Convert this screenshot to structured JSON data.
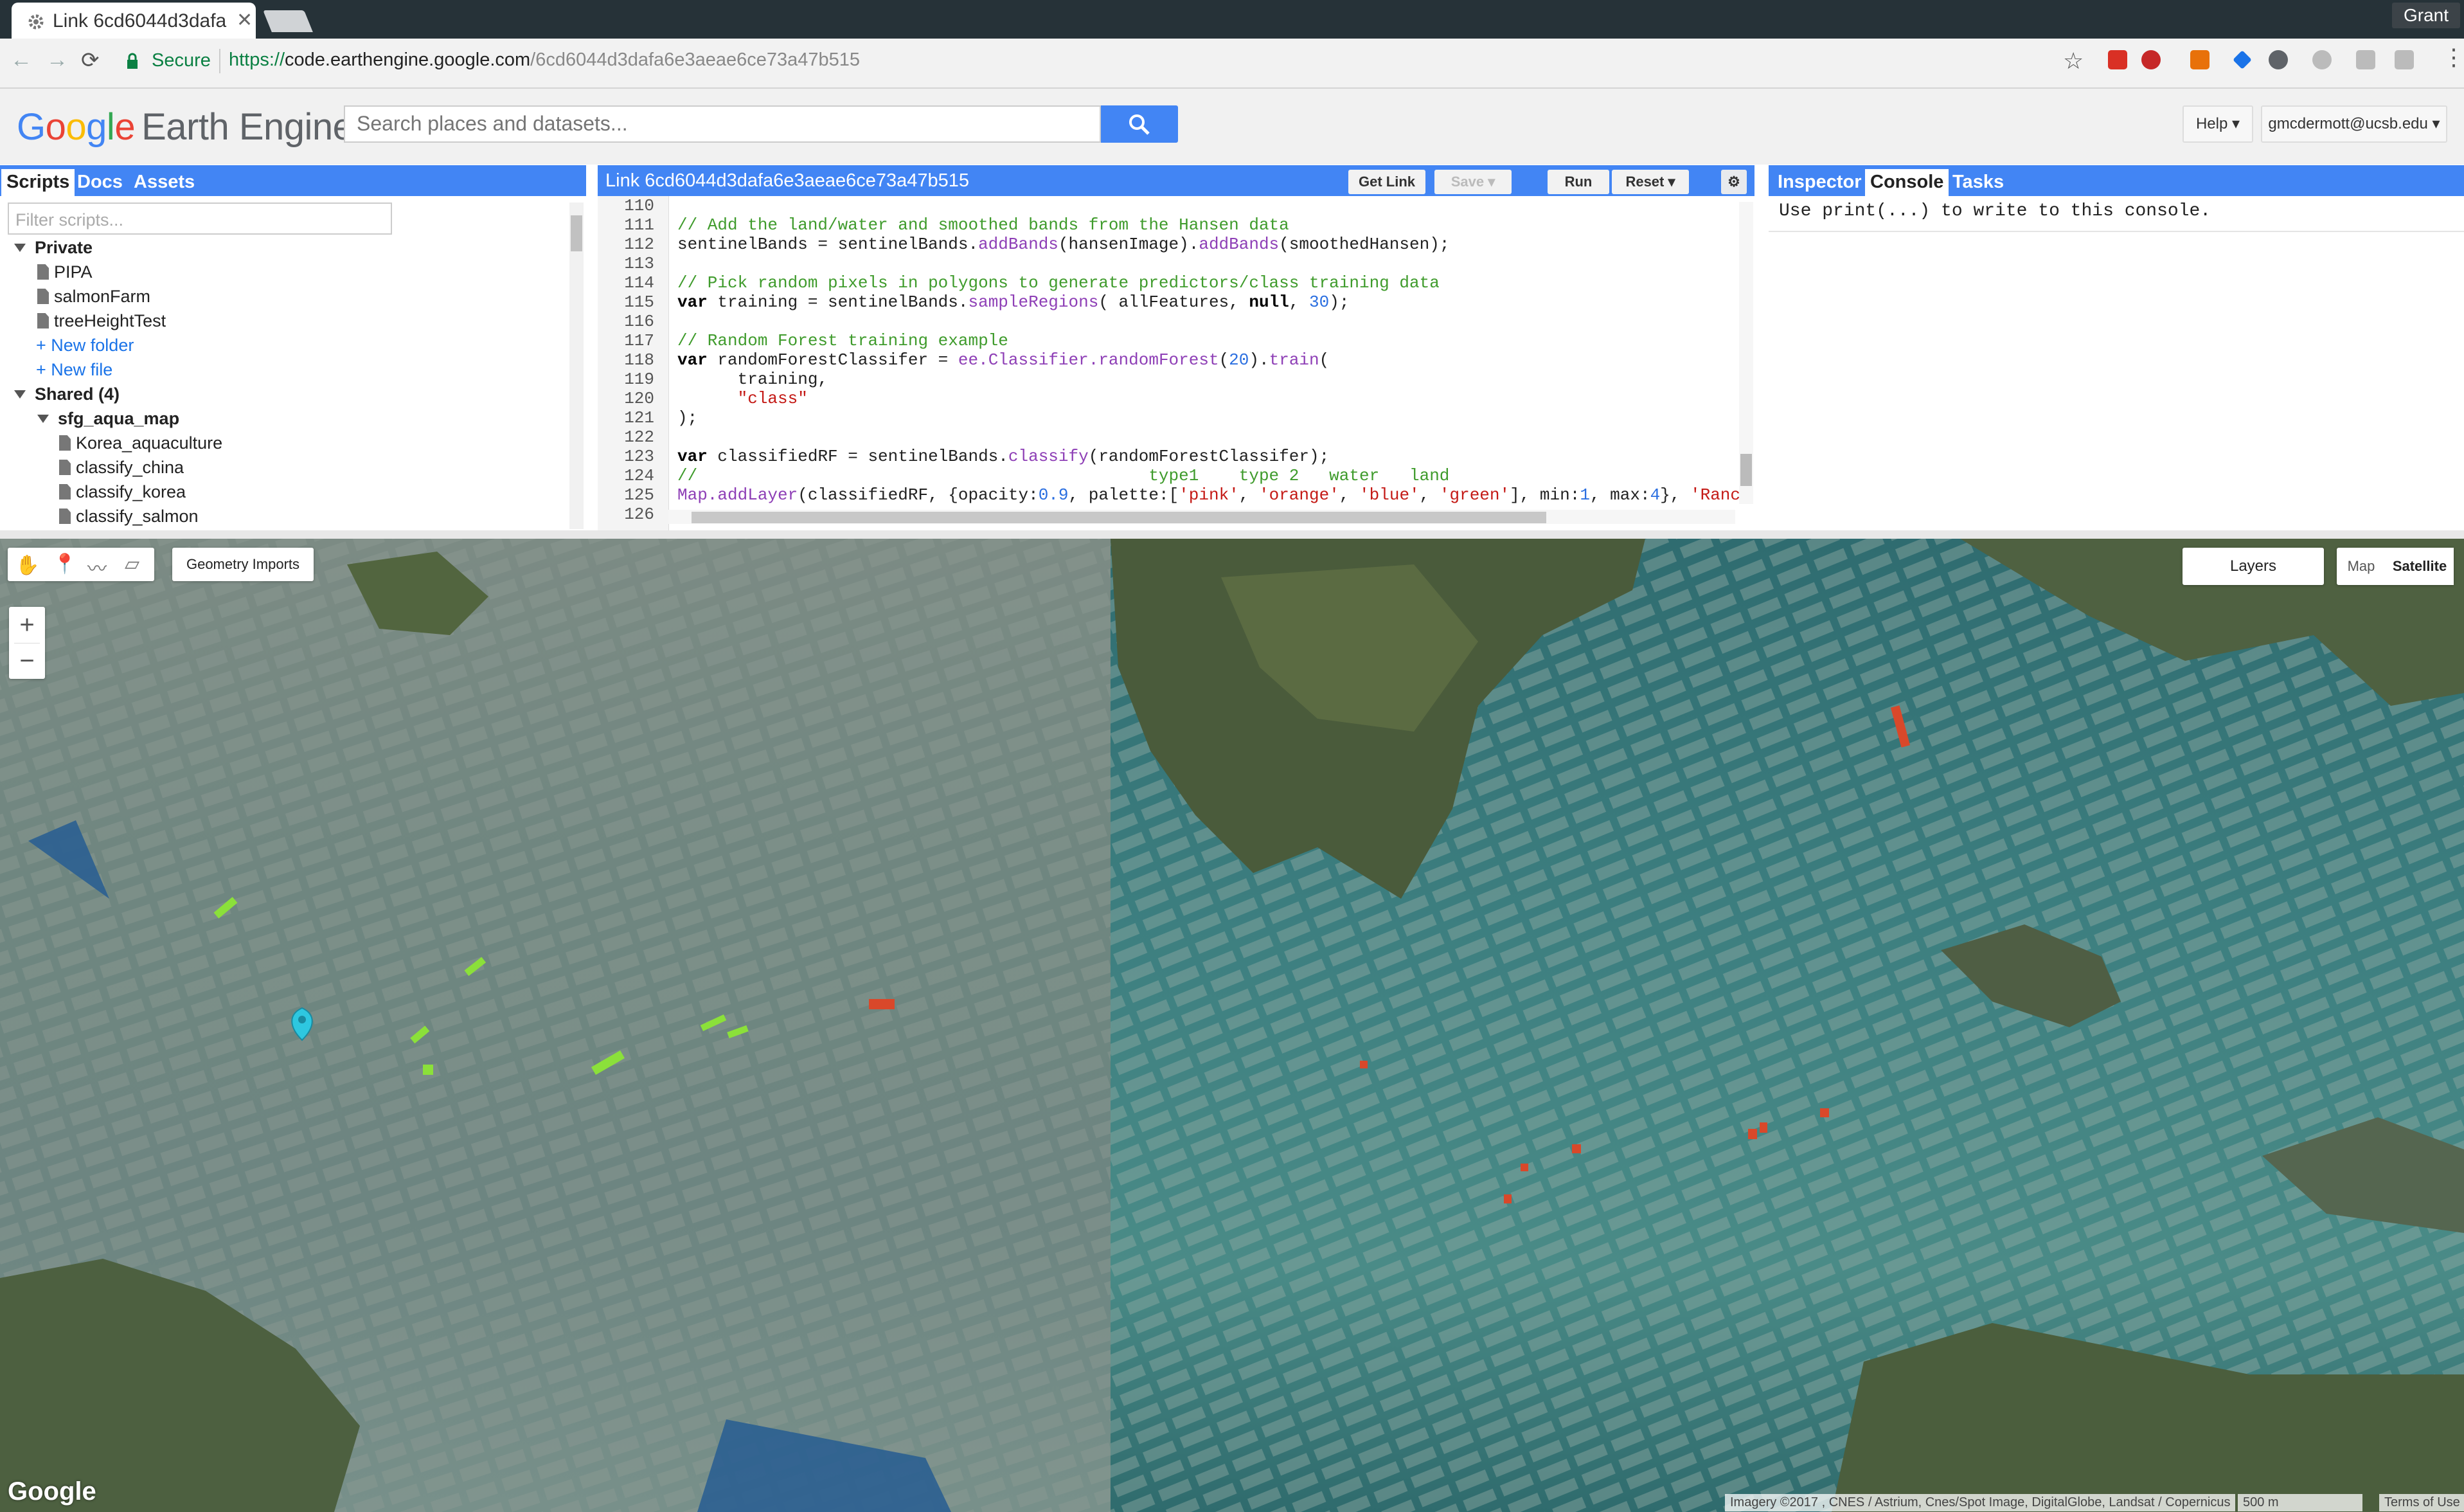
{
  "browser": {
    "tab_title": "Link 6cd6044d3dafa",
    "user_name": "Grant",
    "secure_label": "Secure",
    "url_scheme": "https://",
    "url_host": "code.earthengine.google.com",
    "url_path": "/6cd6044d3dafa6e3aeae6ce73a47b515"
  },
  "app": {
    "logo_google": [
      "G",
      "o",
      "o",
      "g",
      "l",
      "e"
    ],
    "logo_product": "Earth Engine",
    "search_placeholder": "Search places and datasets...",
    "help_label": "Help",
    "account_label": "gmcdermott@ucsb.edu"
  },
  "left_panel": {
    "tabs": [
      "Scripts",
      "Docs",
      "Assets"
    ],
    "filter_placeholder": "Filter scripts...",
    "private_label": "Private",
    "private_items": [
      "PIPA",
      "salmonFarm",
      "treeHeightTest"
    ],
    "new_folder": "+ New folder",
    "new_file": "+ New file",
    "shared_label": "Shared  (4)",
    "shared_folder": "sfg_aqua_map",
    "shared_items": [
      "Korea_aquaculture",
      "classify_china",
      "classify_korea",
      "classify_salmon"
    ]
  },
  "editor": {
    "title": "Link 6cd6044d3dafa6e3aeae6ce73a47b515",
    "get_link": "Get Link",
    "save": "Save",
    "run": "Run",
    "reset": "Reset",
    "line_numbers": [
      "110",
      "111",
      "112",
      "113",
      "114",
      "115",
      "116",
      "117",
      "118",
      "119",
      "120",
      "121",
      "122",
      "123",
      "124",
      "125",
      "126"
    ]
  },
  "right_panel": {
    "tabs": [
      "Inspector",
      "Console",
      "Tasks"
    ],
    "console_text": "Use print(...) to write to this console."
  },
  "map": {
    "geometry_imports": "Geometry Imports",
    "layers": "Layers",
    "map_type_map": "Map",
    "map_type_satellite": "Satellite",
    "zoom_in": "+",
    "zoom_out": "−",
    "attribution": "Imagery ©2017 , CNES / Astrium, Cnes/Spot Image, DigitalGlobe, Landsat / Copernicus",
    "scale": "500 m",
    "terms": "Terms of Use",
    "google_watermark": "Google"
  },
  "colors": {
    "accent": "#4285f4",
    "water_polygon": "#2b5f91",
    "land_marker": "#8be03a",
    "aqua_marker": "#d9482a",
    "point_marker": "#2ec7e0"
  }
}
